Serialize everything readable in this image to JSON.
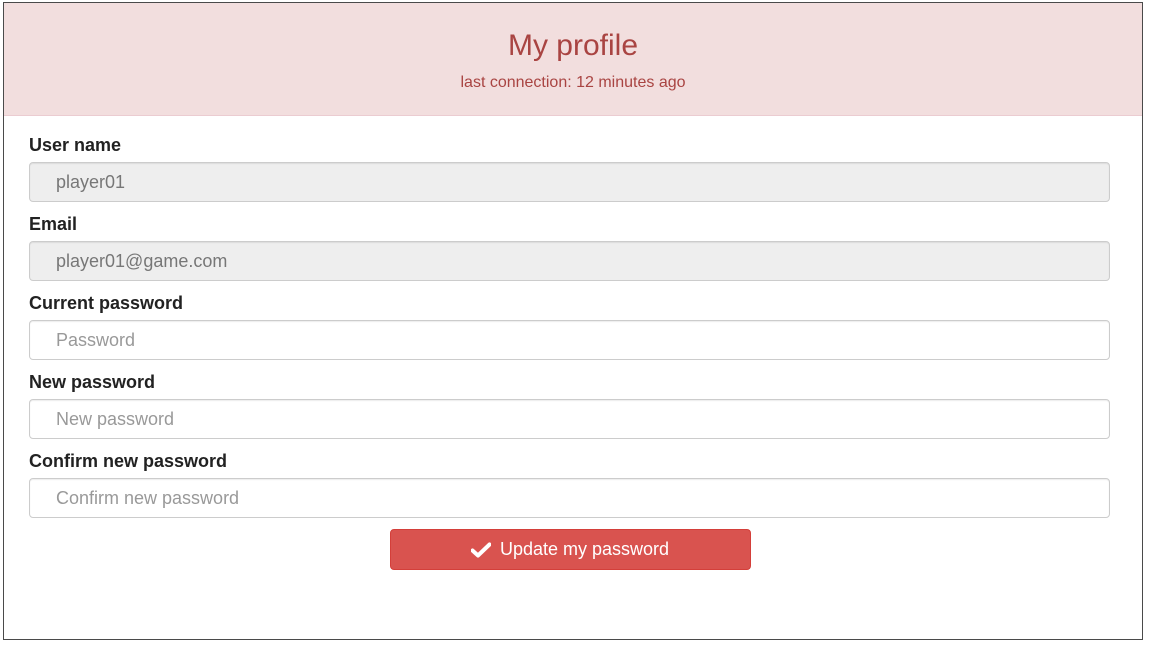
{
  "header": {
    "title": "My profile",
    "subtitle": "last connection: 12 minutes ago"
  },
  "form": {
    "username": {
      "label": "User name",
      "value": "player01"
    },
    "email": {
      "label": "Email",
      "value": "player01@game.com"
    },
    "current_password": {
      "label": "Current password",
      "placeholder": "Password"
    },
    "new_password": {
      "label": "New password",
      "placeholder": "New password"
    },
    "confirm_password": {
      "label": "Confirm new password",
      "placeholder": "Confirm new password"
    }
  },
  "actions": {
    "update_label": "Update my password",
    "update_icon": "check-icon"
  },
  "colors": {
    "header_bg": "#f2dede",
    "header_text": "#a94442",
    "button_bg": "#d9534f"
  }
}
